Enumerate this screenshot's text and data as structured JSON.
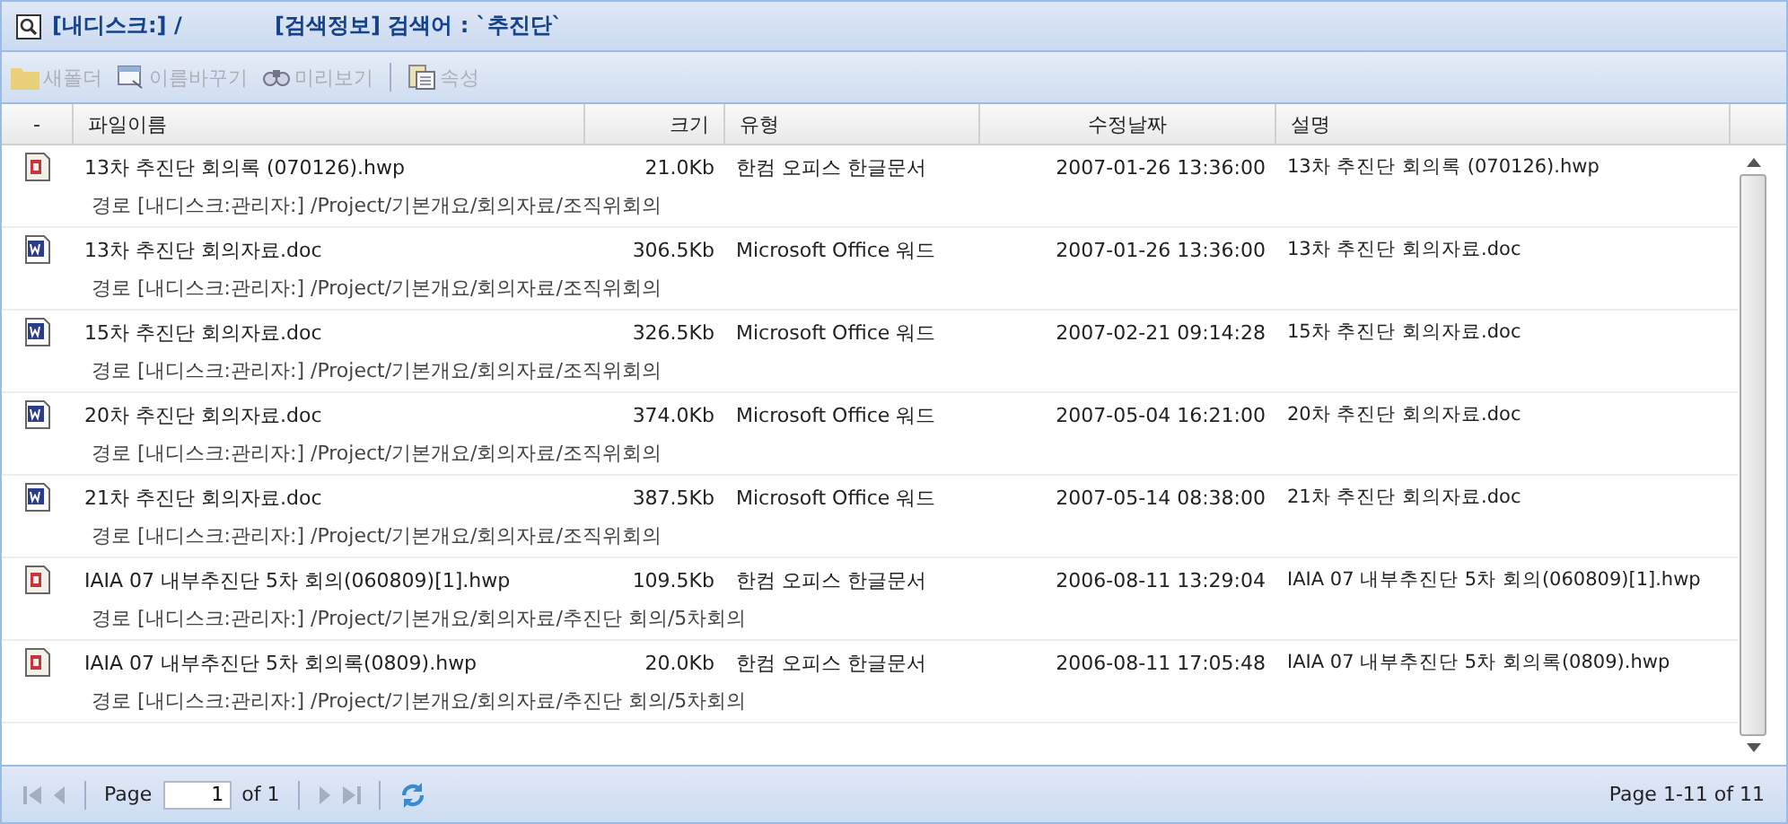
{
  "title": {
    "location": "[내디스크:] /",
    "search": "[검색정보] 검색어 : `추진단`"
  },
  "toolbar": [
    {
      "kind": "folder",
      "label": "새폴더",
      "disabled": true
    },
    {
      "kind": "rename",
      "label": "이름바꾸기",
      "disabled": true
    },
    {
      "kind": "preview",
      "label": "미리보기",
      "disabled": true
    },
    {
      "kind": "properties",
      "label": "속성",
      "disabled": true
    }
  ],
  "columns": [
    "-",
    "파일이름",
    "크기",
    "유형",
    "수정날짜",
    "설명"
  ],
  "rows": [
    {
      "kind": "hwp",
      "name": "13차 추진단 회의록 (070126).hwp",
      "size": "21.0Kb",
      "type": "한컴 오피스 한글문서",
      "modified": "2007-01-26 13:36:00",
      "description": "13차 추진단 회의록 (070126).hwp",
      "path": "경로 [내디스크:관리자:] /Project/기본개요/회의자료/조직위회의"
    },
    {
      "kind": "doc",
      "name": "13차 추진단 회의자료.doc",
      "size": "306.5Kb",
      "type": "Microsoft Office 워드",
      "modified": "2007-01-26 13:36:00",
      "description": "13차 추진단 회의자료.doc",
      "path": "경로 [내디스크:관리자:] /Project/기본개요/회의자료/조직위회의"
    },
    {
      "kind": "doc",
      "name": "15차 추진단 회의자료.doc",
      "size": "326.5Kb",
      "type": "Microsoft Office 워드",
      "modified": "2007-02-21 09:14:28",
      "description": "15차 추진단 회의자료.doc",
      "path": "경로 [내디스크:관리자:] /Project/기본개요/회의자료/조직위회의"
    },
    {
      "kind": "doc",
      "name": "20차 추진단 회의자료.doc",
      "size": "374.0Kb",
      "type": "Microsoft Office 워드",
      "modified": "2007-05-04 16:21:00",
      "description": "20차 추진단 회의자료.doc",
      "path": "경로 [내디스크:관리자:] /Project/기본개요/회의자료/조직위회의"
    },
    {
      "kind": "doc",
      "name": "21차 추진단 회의자료.doc",
      "size": "387.5Kb",
      "type": "Microsoft Office 워드",
      "modified": "2007-05-14 08:38:00",
      "description": "21차 추진단 회의자료.doc",
      "path": "경로 [내디스크:관리자:] /Project/기본개요/회의자료/조직위회의"
    },
    {
      "kind": "hwp",
      "name": "IAIA 07 내부추진단 5차 회의(060809)[1].hwp",
      "size": "109.5Kb",
      "type": "한컴 오피스 한글문서",
      "modified": "2006-08-11 13:29:04",
      "description": "IAIA 07 내부추진단 5차 회의(060809)[1].hwp",
      "path": "경로 [내디스크:관리자:] /Project/기본개요/회의자료/추진단 회의/5차회의"
    },
    {
      "kind": "hwp",
      "name": "IAIA 07 내부추진단 5차 회의록(0809).hwp",
      "size": "20.0Kb",
      "type": "한컴 오피스 한글문서",
      "modified": "2006-08-11 17:05:48",
      "description": "IAIA 07 내부추진단 5차 회의록(0809).hwp",
      "path": "경로 [내디스크:관리자:] /Project/기본개요/회의자료/추진단 회의/5차회의"
    }
  ],
  "pager": {
    "label": "Page",
    "page": "1",
    "of": "of 1",
    "first_disabled": true,
    "prev_disabled": true,
    "next_disabled": true,
    "last_disabled": true,
    "summary": "Page 1-11 of 11"
  }
}
